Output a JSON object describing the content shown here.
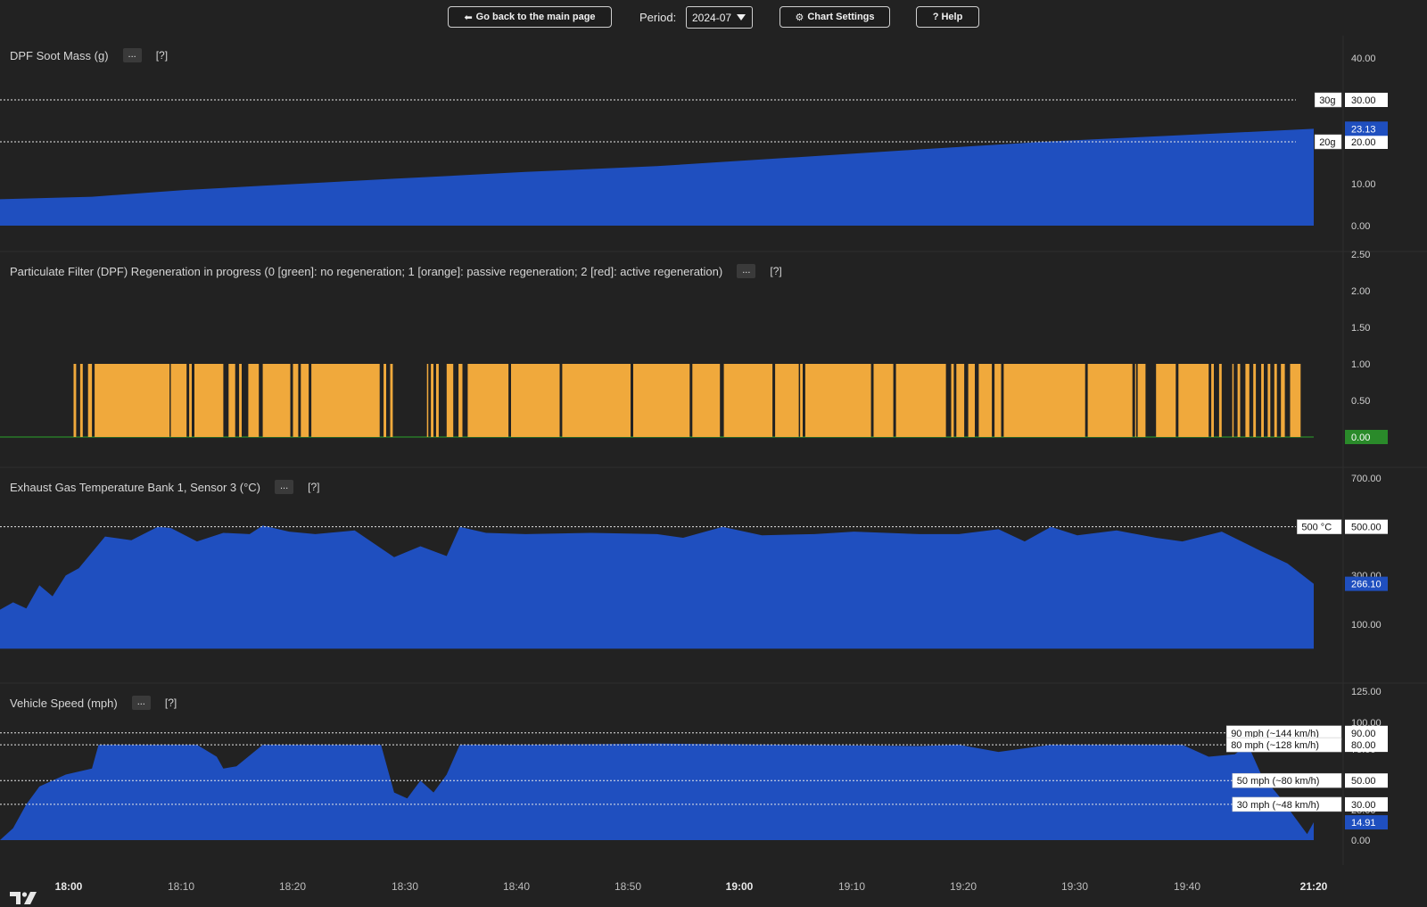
{
  "toolbar": {
    "back_label": "Go back to the main page",
    "period_label": "Period:",
    "period_value": "2024-07",
    "settings_label": "Chart Settings",
    "help_label": "? Help"
  },
  "colors": {
    "background": "#222222",
    "series_blue": "#1f4fbf",
    "regen_orange": "#f0a93c",
    "regen_green": "#2a8a2a",
    "label_blue_bg": "#1f4fbf",
    "label_green_bg": "#2a8a2a"
  },
  "time_axis": {
    "ticks": [
      "18:00",
      "18:10",
      "18:20",
      "18:30",
      "18:40",
      "18:50",
      "19:00",
      "19:10",
      "19:20",
      "19:30",
      "19:40",
      "21:20"
    ],
    "bold": [
      "18:00",
      "19:00",
      "21:20"
    ]
  },
  "chart_data": [
    {
      "type": "area",
      "title": "DPF Soot Mass (g)",
      "y_ticks": [
        "0.00",
        "10.00",
        "20.00",
        "30.00",
        "40.00"
      ],
      "ylim": [
        0,
        40
      ],
      "last_value": "23.13",
      "reference_lines": [
        {
          "value": 30,
          "label": "30g",
          "axis_label": "30.00"
        },
        {
          "value": 20,
          "label": "20g",
          "axis_label": "20.00"
        }
      ],
      "series": [
        {
          "name": "DPF Soot Mass",
          "points": [
            [
              0,
              6.3
            ],
            [
              0.07,
              6.9
            ],
            [
              0.14,
              8.5
            ],
            [
              0.2,
              9.5
            ],
            [
              0.3,
              11.2
            ],
            [
              0.4,
              12.8
            ],
            [
              0.5,
              14.2
            ],
            [
              0.6,
              16.2
            ],
            [
              0.7,
              18.2
            ],
            [
              0.8,
              20.1
            ],
            [
              0.9,
              21.6
            ],
            [
              1,
              23.1
            ]
          ]
        }
      ]
    },
    {
      "type": "area",
      "title": "Particulate Filter (DPF) Regeneration in progress (0 [green]: no regeneration; 1 [orange]: passive regeneration; 2 [red]: active regeneration)",
      "y_ticks": [
        "0.00",
        "0.50",
        "1.00",
        "1.50",
        "2.00",
        "2.50"
      ],
      "ylim": [
        0,
        2.5
      ],
      "last_value": "0.00",
      "series": [
        {
          "name": "Regeneration state",
          "segments_value_1": [
            [
              0.056,
              0.058
            ],
            [
              0.061,
              0.063
            ],
            [
              0.067,
              0.07
            ],
            [
              0.072,
              0.129
            ],
            [
              0.13,
              0.142
            ],
            [
              0.144,
              0.146
            ],
            [
              0.148,
              0.17
            ],
            [
              0.174,
              0.179
            ],
            [
              0.182,
              0.184
            ],
            [
              0.189,
              0.197
            ],
            [
              0.2,
              0.221
            ],
            [
              0.223,
              0.227
            ],
            [
              0.229,
              0.235
            ],
            [
              0.237,
              0.289
            ],
            [
              0.292,
              0.294
            ],
            [
              0.297,
              0.299
            ],
            [
              0.325,
              0.326
            ],
            [
              0.328,
              0.33
            ],
            [
              0.332,
              0.334
            ],
            [
              0.34,
              0.345
            ],
            [
              0.349,
              0.352
            ],
            [
              0.356,
              0.387
            ],
            [
              0.389,
              0.426
            ],
            [
              0.428,
              0.48
            ],
            [
              0.482,
              0.525
            ],
            [
              0.527,
              0.548
            ],
            [
              0.551,
              0.588
            ],
            [
              0.59,
              0.608
            ],
            [
              0.609,
              0.611
            ],
            [
              0.613,
              0.663
            ],
            [
              0.665,
              0.68
            ],
            [
              0.682,
              0.72
            ],
            [
              0.724,
              0.726
            ],
            [
              0.728,
              0.734
            ],
            [
              0.737,
              0.742
            ],
            [
              0.745,
              0.755
            ],
            [
              0.757,
              0.762
            ],
            [
              0.764,
              0.826
            ],
            [
              0.828,
              0.862
            ],
            [
              0.864,
              0.864
            ],
            [
              0.866,
              0.872
            ],
            [
              0.88,
              0.895
            ],
            [
              0.897,
              0.92
            ],
            [
              0.922,
              0.924
            ],
            [
              0.928,
              0.93
            ],
            [
              0.938,
              0.939
            ],
            [
              0.942,
              0.944
            ],
            [
              0.948,
              0.951
            ],
            [
              0.954,
              0.956
            ],
            [
              0.96,
              0.962
            ],
            [
              0.965,
              0.967
            ],
            [
              0.97,
              0.972
            ],
            [
              0.975,
              0.978
            ],
            [
              0.982,
              0.99
            ]
          ]
        }
      ]
    },
    {
      "type": "area",
      "title": "Exhaust Gas Temperature Bank 1, Sensor 3 (°C)",
      "y_ticks": [
        "100.00",
        "300.00",
        "500.00",
        "700.00"
      ],
      "ylim": [
        0,
        700
      ],
      "last_value": "266.10",
      "reference_lines": [
        {
          "value": 500,
          "label": "500 °C",
          "axis_label": "500.00"
        }
      ],
      "series": [
        {
          "name": "EGT B1S3",
          "points": [
            [
              0,
              160
            ],
            [
              0.01,
              190
            ],
            [
              0.02,
              165
            ],
            [
              0.03,
              260
            ],
            [
              0.04,
              215
            ],
            [
              0.05,
              300
            ],
            [
              0.06,
              330
            ],
            [
              0.08,
              460
            ],
            [
              0.1,
              445
            ],
            [
              0.12,
              500
            ],
            [
              0.13,
              495
            ],
            [
              0.15,
              440
            ],
            [
              0.17,
              475
            ],
            [
              0.19,
              470
            ],
            [
              0.2,
              505
            ],
            [
              0.22,
              480
            ],
            [
              0.24,
              470
            ],
            [
              0.27,
              485
            ],
            [
              0.3,
              375
            ],
            [
              0.32,
              420
            ],
            [
              0.34,
              380
            ],
            [
              0.35,
              500
            ],
            [
              0.37,
              475
            ],
            [
              0.4,
              470
            ],
            [
              0.45,
              475
            ],
            [
              0.5,
              470
            ],
            [
              0.52,
              455
            ],
            [
              0.55,
              500
            ],
            [
              0.58,
              465
            ],
            [
              0.62,
              470
            ],
            [
              0.65,
              480
            ],
            [
              0.7,
              470
            ],
            [
              0.73,
              470
            ],
            [
              0.76,
              490
            ],
            [
              0.78,
              440
            ],
            [
              0.8,
              500
            ],
            [
              0.82,
              465
            ],
            [
              0.85,
              485
            ],
            [
              0.88,
              455
            ],
            [
              0.9,
              440
            ],
            [
              0.93,
              480
            ],
            [
              0.96,
              400
            ],
            [
              0.98,
              350
            ],
            [
              1,
              266
            ]
          ]
        }
      ]
    },
    {
      "type": "area",
      "title": "Vehicle Speed (mph)",
      "y_ticks": [
        "0.00",
        "25.00",
        "75.00",
        "100.00",
        "125.00"
      ],
      "ylim": [
        0,
        125
      ],
      "last_value": "14.91",
      "reference_lines": [
        {
          "value": 90,
          "label": "90 mph (~144 km/h)",
          "axis_label": "90.00"
        },
        {
          "value": 80,
          "label": "80 mph (~128 km/h)",
          "axis_label": "80.00"
        },
        {
          "value": 50,
          "label": "50 mph (~80 km/h)",
          "axis_label": "50.00"
        },
        {
          "value": 30,
          "label": "30 mph (~48 km/h)",
          "axis_label": "30.00"
        }
      ],
      "series": [
        {
          "name": "Vehicle Speed",
          "points": [
            [
              0,
              0
            ],
            [
              0.01,
              10
            ],
            [
              0.02,
              30
            ],
            [
              0.03,
              45
            ],
            [
              0.05,
              55
            ],
            [
              0.07,
              60
            ],
            [
              0.075,
              80
            ],
            [
              0.1,
              80
            ],
            [
              0.15,
              80
            ],
            [
              0.165,
              70
            ],
            [
              0.17,
              60
            ],
            [
              0.18,
              62
            ],
            [
              0.2,
              80
            ],
            [
              0.25,
              80
            ],
            [
              0.29,
              80
            ],
            [
              0.3,
              40
            ],
            [
              0.31,
              35
            ],
            [
              0.32,
              50
            ],
            [
              0.33,
              40
            ],
            [
              0.34,
              55
            ],
            [
              0.35,
              80
            ],
            [
              0.4,
              80
            ],
            [
              0.5,
              81
            ],
            [
              0.6,
              80
            ],
            [
              0.7,
              79
            ],
            [
              0.73,
              80
            ],
            [
              0.76,
              74
            ],
            [
              0.8,
              80
            ],
            [
              0.85,
              80
            ],
            [
              0.9,
              80
            ],
            [
              0.92,
              70
            ],
            [
              0.94,
              72
            ],
            [
              0.95,
              80
            ],
            [
              0.96,
              55
            ],
            [
              0.975,
              35
            ],
            [
              0.985,
              20
            ],
            [
              0.995,
              5
            ],
            [
              1,
              15
            ]
          ]
        }
      ]
    }
  ]
}
